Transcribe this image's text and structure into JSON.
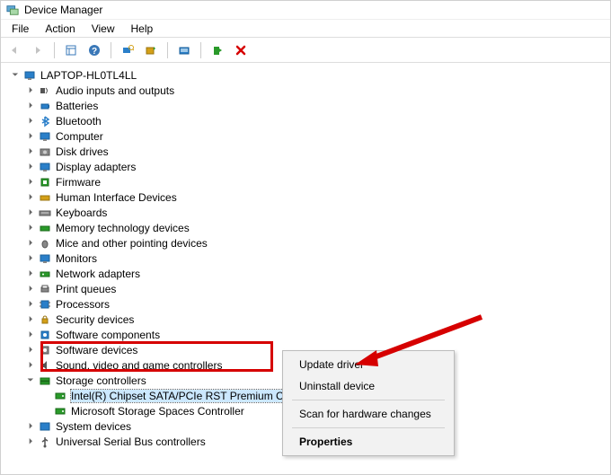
{
  "window": {
    "title": "Device Manager"
  },
  "menubar": {
    "file": "File",
    "action": "Action",
    "view": "View",
    "help": "Help"
  },
  "tree": {
    "root": "LAPTOP-HL0TL4LL",
    "categories": {
      "audio": "Audio inputs and outputs",
      "batteries": "Batteries",
      "bluetooth": "Bluetooth",
      "computer": "Computer",
      "disk": "Disk drives",
      "display": "Display adapters",
      "firmware": "Firmware",
      "hid": "Human Interface Devices",
      "keyboards": "Keyboards",
      "memtech": "Memory technology devices",
      "mice": "Mice and other pointing devices",
      "monitors": "Monitors",
      "network": "Network adapters",
      "printq": "Print queues",
      "processors": "Processors",
      "security": "Security devices",
      "swcomp": "Software components",
      "swdev": "Software devices",
      "sound": "Sound, video and game controllers",
      "storage": "Storage controllers",
      "sysdev": "System devices",
      "usb": "Universal Serial Bus controllers"
    },
    "storage_children": {
      "intel": "Intel(R) Chipset SATA/PCIe RST Premium Controller",
      "msspaces": "Microsoft Storage Spaces Controller"
    }
  },
  "context_menu": {
    "update": "Update driver",
    "uninstall": "Uninstall device",
    "scan": "Scan for hardware changes",
    "properties": "Properties"
  }
}
